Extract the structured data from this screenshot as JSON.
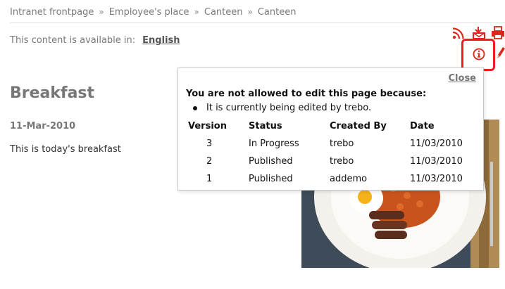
{
  "breadcrumb": [
    "Intranet frontpage",
    "Employee's place",
    "Canteen",
    "Canteen"
  ],
  "breadcrumb_separator": "»",
  "language": {
    "label": "This content is available in:",
    "link": "English"
  },
  "toolbar_icons": [
    "rss-icon",
    "subscribe-icon",
    "print-icon",
    "info-icon",
    "edit-icon"
  ],
  "highlight_color": "#ee1c25",
  "accent_color": "#d9271c",
  "article": {
    "title": "Breakfast",
    "date": "11-Mar-2010",
    "body": "This is today's breakfast"
  },
  "popup": {
    "close_label": "Close",
    "heading": "You are not allowed to edit this page because:",
    "reason": "It is currently being edited by trebo.",
    "columns": [
      "Version",
      "Status",
      "Created By",
      "Date"
    ],
    "rows": [
      [
        "3",
        "In Progress",
        "trebo",
        "11/03/2010"
      ],
      [
        "2",
        "Published",
        "trebo",
        "11/03/2010"
      ],
      [
        "1",
        "Published",
        "addemo",
        "11/03/2010"
      ]
    ]
  }
}
